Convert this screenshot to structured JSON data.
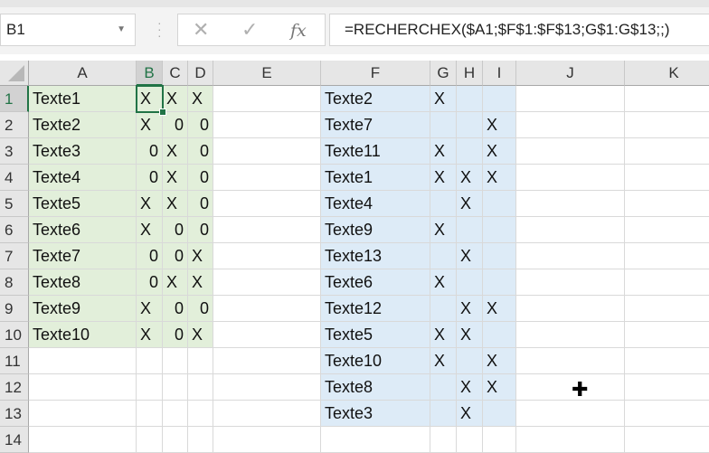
{
  "name_box": "B1",
  "formula_bar": {
    "cancel_icon": "✕",
    "enter_icon": "✓",
    "fx_label": "fx",
    "formula": "=RECHERCHEX($A1;$F$1:$F$13;G$1:G$13;;)"
  },
  "selected_cell": "B1",
  "columns": [
    "A",
    "B",
    "C",
    "D",
    "E",
    "F",
    "G",
    "H",
    "I",
    "J",
    "K"
  ],
  "rows": [
    "1",
    "2",
    "3",
    "4",
    "5",
    "6",
    "7",
    "8",
    "9",
    "10",
    "11",
    "12",
    "13",
    "14"
  ],
  "colors": {
    "green_fill": "#e2efda",
    "blue_fill": "#ddebf7",
    "accent": "#217346"
  },
  "table_left": [
    [
      "Texte1",
      "X",
      "X",
      "X"
    ],
    [
      "Texte2",
      "X",
      "0",
      "0"
    ],
    [
      "Texte3",
      "0",
      "X",
      "0"
    ],
    [
      "Texte4",
      "0",
      "X",
      "0"
    ],
    [
      "Texte5",
      "X",
      "X",
      "0"
    ],
    [
      "Texte6",
      "X",
      "0",
      "0"
    ],
    [
      "Texte7",
      "0",
      "0",
      "X"
    ],
    [
      "Texte8",
      "0",
      "X",
      "X"
    ],
    [
      "Texte9",
      "X",
      "0",
      "0"
    ],
    [
      "Texte10",
      "X",
      "0",
      "X"
    ]
  ],
  "table_right": [
    [
      "Texte2",
      "X",
      "",
      ""
    ],
    [
      "Texte7",
      "",
      "",
      "X"
    ],
    [
      "Texte11",
      "X",
      "",
      "X"
    ],
    [
      "Texte1",
      "X",
      "X",
      "X"
    ],
    [
      "Texte4",
      "",
      "X",
      ""
    ],
    [
      "Texte9",
      "X",
      "",
      ""
    ],
    [
      "Texte13",
      "",
      "X",
      ""
    ],
    [
      "Texte6",
      "X",
      "",
      ""
    ],
    [
      "Texte12",
      "",
      "X",
      "X"
    ],
    [
      "Texte5",
      "X",
      "X",
      ""
    ],
    [
      "Texte10",
      "X",
      "",
      "X"
    ],
    [
      "Texte8",
      "",
      "X",
      "X"
    ],
    [
      "Texte3",
      "",
      "X",
      ""
    ]
  ]
}
